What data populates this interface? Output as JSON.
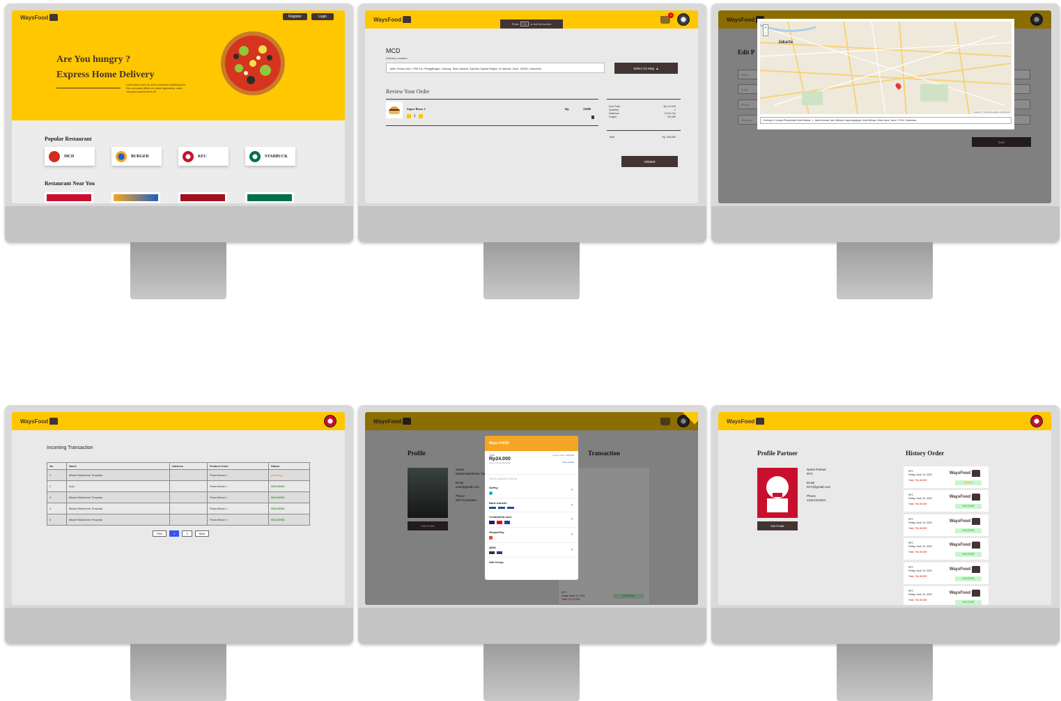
{
  "brand": "WaysFood",
  "monitor1": {
    "register": "Register",
    "login": "Login",
    "hero_line1": "Are You hungry ?",
    "hero_line2": "Express Home Delivery",
    "hero_text": "Lorem ipsum dolor sit, amet consectetur adipisicing elit. Eos cum quam officia non neque dignissimos, natus numquam quaerat amet sit?",
    "popular_title": "Popular Restaurant",
    "restaurants": [
      "MCD",
      "BURGER",
      "KFC",
      "STARBUCK"
    ],
    "near_title": "Restaurant Near You"
  },
  "monitor2": {
    "fullscreen_hint_pre": "Press",
    "fullscreen_key": "F11",
    "fullscreen_hint_post": "to exit full screen",
    "cart_count": "1",
    "restaurant": "MCD",
    "delivery_label": "Delivery Location",
    "address": "Jalan Teman Asri I, RW 16, Penggilingan, Cakung, East Jakarta, Special Capital Region of Jakarta, Java, 13940, Indonesia",
    "select_map": "Select On Map",
    "review_title": "Review Your Order",
    "item_name": "Super Besar 1",
    "item_currency": "Rp",
    "item_price": "24000",
    "item_qty": "1",
    "summary": [
      {
        "label": "Sub Total",
        "value": "Rp 24.000"
      },
      {
        "label": "Quantity",
        "value": "1"
      },
      {
        "label": "Distance",
        "value": "10.51 Km"
      },
      {
        "label": "Ongkir",
        "value": "84,080"
      }
    ],
    "total_label": "Total",
    "total_value": "Rp 108,080",
    "order_button": "ORDER"
  },
  "monitor3": {
    "edit_title": "Edit P",
    "fields": [
      "Name",
      "Email",
      "Phone",
      "Gedung"
    ],
    "map_city": "Jakarta",
    "map_address": "Gedung 10 Lantai Pemerintah Kota Bekasi, 1, Jalan Ahmad Yani, Bekasi, Kayuringinjaya, Kota Bekasi, West Java, Java, 17144, Indonesia",
    "map_attribution": "Leaflet | © OpenStreetMap contributors",
    "save_button": "Save"
  },
  "monitor4": {
    "title": "Incoming Transaction",
    "columns": [
      "No",
      "Name",
      "Address",
      "Product Order",
      "Status"
    ],
    "rows": [
      {
        "no": "1",
        "name": "Misael Malchiram Timpolas",
        "address": "-",
        "product": "Paras Besar 1",
        "status": "pending"
      },
      {
        "no": "2",
        "name": "hola",
        "address": "-",
        "product": "Paras Besar 1",
        "status": "SUCCESS"
      },
      {
        "no": "3",
        "name": "Misael Malchiram Timpolas",
        "address": "-",
        "product": "Paras Besar 1",
        "status": "SUCCESS"
      },
      {
        "no": "4",
        "name": "Misael Malchiram Timpolas",
        "address": "-",
        "product": "Paras Besar 1",
        "status": "SUCCESS"
      },
      {
        "no": "5",
        "name": "Misael Malchiram Timpolas",
        "address": "-",
        "product": "Paras Besar 1",
        "status": "SUCCESS"
      }
    ],
    "prev": "Prev",
    "pages": [
      "1",
      "2"
    ],
    "next": "Next"
  },
  "monitor5": {
    "profile_title": "Profile",
    "history_title": "Transaction",
    "name_label": "Name",
    "name_value": "Misael Malchiram Timpolas",
    "email_label": "Email",
    "email_value": "user@gmail.com",
    "phone_label": "Phone",
    "phone_value": "087712341564",
    "edit_profile": "Edit Profile",
    "history_item_title": "KFC",
    "history_item_date": "Friday, June 10, 2022",
    "history_item_total": "Total : Rp 13.000",
    "history_item_status": "SUCCESS",
    "modal_title": "Ways FOOD",
    "total_label": "Total",
    "total_amount": "Rp24.000",
    "order_id": "Order ID #1655094355",
    "choose_within": "Choose within",
    "countdown": "23:59:59",
    "order_details": "Order details",
    "select_method": "Select payment method",
    "methods": [
      "GoPay",
      "Bank transfer",
      "Credit/debit card",
      "ShopeePay",
      "QRIS",
      "Alfa Group"
    ]
  },
  "monitor6": {
    "profile_title": "Profile Partner",
    "history_title": "History Order",
    "name_label": "Name Partner",
    "name_value": "KFC",
    "email_label": "Email",
    "email_value": "KFC@gmail.com",
    "phone_label": "Phone",
    "phone_value": "12312312312",
    "edit_profile": "Edit Profile",
    "history_item_title": "KFC",
    "history_item_date": "Friday, June 10, 2022",
    "history_item_total": "Total : Rp 36.000",
    "statuses": [
      "pending",
      "SUCCESS",
      "SUCCESS",
      "SUCCESS",
      "SUCCESS",
      "SUCCESS"
    ]
  }
}
